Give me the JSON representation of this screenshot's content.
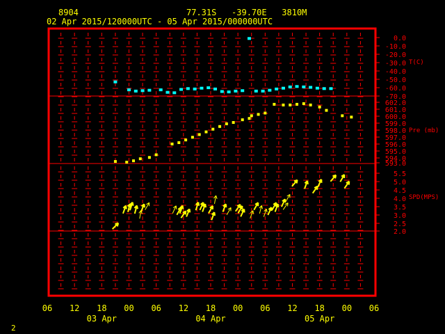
{
  "header": {
    "station_id": "8904",
    "location": "77.31S   -39.70E   3810M",
    "time_range": "02 Apr 2015/120000UTC - 05 Apr 2015/000000UTC"
  },
  "footer": {
    "page_number": "2"
  },
  "colors": {
    "frame": "#ff0000",
    "temperature": "#00ffff",
    "pressure": "#ffff00",
    "wind": "#ffff00",
    "axis_text": "#ffff00",
    "right_labels": "#ff0000"
  },
  "chart_data": [
    {
      "type": "scatter",
      "ylabel": "T(C)",
      "ylim": [
        -70,
        0
      ],
      "y_ticks": [
        "0.0",
        "-10.0",
        "-20.0",
        "-30.0",
        "-40.0",
        "-50.0",
        "-60.0",
        "-70.0"
      ],
      "x_unit": "hours since 02 Apr 2015 06UTC",
      "x": [
        30,
        36,
        39,
        42,
        45,
        50,
        53,
        56,
        59,
        62,
        65,
        68,
        71,
        74,
        77,
        80,
        83,
        86,
        89,
        92,
        95,
        98,
        101,
        104,
        107,
        110,
        113,
        116,
        119,
        122,
        125
      ],
      "values": [
        -53.5,
        -63,
        -64.5,
        -64,
        -63.5,
        -63,
        -66,
        -66.5,
        -62.5,
        -61.5,
        -62,
        -61,
        -60.5,
        -62,
        -65,
        -65.5,
        -64.5,
        -64,
        -1.5,
        -64.5,
        -64.5,
        -63.5,
        -62,
        -61,
        -59.5,
        -59,
        -59.5,
        -60,
        -61,
        -61.5,
        -61.5
      ]
    },
    {
      "type": "scatter",
      "ylabel": "Pre (mb)",
      "ylim": [
        593,
        602
      ],
      "y_ticks": [
        "602.0",
        "601.0",
        "600.0",
        "599.0",
        "598.0",
        "597.0",
        "596.0",
        "595.0",
        "594.0",
        "593.0"
      ],
      "x_unit": "hours since 02 Apr 2015 06UTC",
      "x": [
        30,
        35,
        38,
        41,
        45,
        48,
        55,
        58,
        61,
        64,
        67,
        70,
        73,
        76,
        79,
        82,
        86,
        89,
        90,
        93,
        96,
        100,
        104,
        107,
        110,
        113,
        116,
        120,
        123,
        130,
        134
      ],
      "values": [
        593.2,
        593.1,
        593.3,
        593.6,
        593.8,
        594.2,
        595.8,
        596.0,
        596.4,
        596.8,
        597.2,
        597.6,
        598.0,
        598.4,
        598.8,
        599.0,
        599.4,
        599.6,
        600.0,
        600.2,
        600.4,
        601.7,
        601.6,
        601.6,
        601.7,
        601.8,
        601.6,
        601.3,
        600.8,
        600.0,
        599.8
      ]
    },
    {
      "type": "vector",
      "ylabel": "SPD(MPS)",
      "ylim": [
        2,
        5.5
      ],
      "y_ticks": [
        "5.5",
        "5.0",
        "4.5",
        "4.0",
        "3.5",
        "3.0",
        "2.5",
        "2.0"
      ],
      "x_unit": "hours since 02 Apr 2015 06UTC",
      "x": [
        30,
        34,
        36,
        37,
        39,
        41,
        42,
        44,
        56,
        58,
        59,
        60,
        62,
        66,
        68,
        69,
        72,
        73,
        74,
        78,
        80,
        84,
        85,
        86,
        90,
        92,
        94,
        96,
        98,
        100,
        101,
        104,
        105,
        106,
        109,
        114,
        118,
        120,
        126,
        130,
        132
      ],
      "values": [
        2.3,
        3.3,
        3.4,
        3.5,
        3.3,
        3.0,
        3.4,
        3.5,
        3.3,
        3.2,
        3.3,
        3.0,
        3.1,
        3.5,
        3.5,
        3.4,
        3.3,
        2.9,
        3.9,
        3.4,
        3.2,
        3.4,
        3.3,
        3.1,
        3.0,
        3.5,
        3.3,
        3.1,
        3.2,
        3.5,
        3.4,
        3.7,
        3.5,
        4.0,
        4.9,
        4.8,
        4.5,
        4.9,
        5.2,
        5.2,
        4.8
      ],
      "directions_deg": [
        45,
        20,
        15,
        18,
        15,
        10,
        22,
        30,
        25,
        30,
        20,
        35,
        22,
        18,
        25,
        20,
        30,
        20,
        10,
        20,
        30,
        35,
        30,
        25,
        20,
        30,
        15,
        20,
        25,
        30,
        20,
        25,
        35,
        30,
        40,
        20,
        35,
        25,
        40,
        30,
        35
      ],
      "heavy": [
        true,
        true,
        true,
        true,
        true,
        false,
        true,
        false,
        false,
        true,
        true,
        true,
        true,
        true,
        true,
        true,
        true,
        true,
        false,
        true,
        false,
        true,
        true,
        true,
        false,
        true,
        false,
        false,
        true,
        true,
        true,
        true,
        false,
        false,
        true,
        true,
        true,
        true,
        true,
        true,
        true
      ]
    }
  ],
  "x_axis": {
    "tick_labels": [
      "06",
      "12",
      "18",
      "00",
      "06",
      "12",
      "18",
      "00",
      "06",
      "12",
      "18",
      "00",
      "06"
    ],
    "day_labels": [
      "03 Apr",
      "04 Apr",
      "05 Apr"
    ]
  }
}
